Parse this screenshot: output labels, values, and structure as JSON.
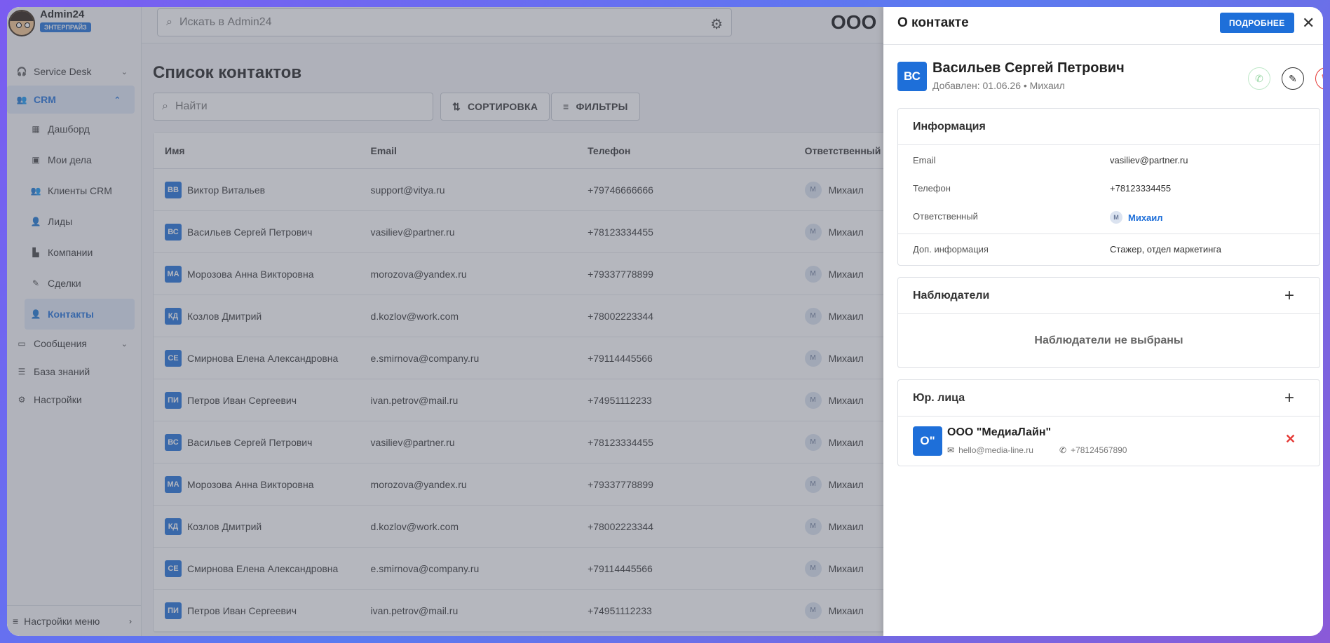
{
  "brand": {
    "name": "Admin24",
    "badge": "ЭНТЕРПРАЙЗ"
  },
  "topbar": {
    "search_placeholder": "Искать в Admin24",
    "org_title": "ООО \""
  },
  "sidebar": {
    "items": [
      {
        "label": "Service Desk"
      },
      {
        "label": "CRM"
      },
      {
        "label": "Дашборд"
      },
      {
        "label": "Мои дела"
      },
      {
        "label": "Клиенты CRM"
      },
      {
        "label": "Лиды"
      },
      {
        "label": "Компании"
      },
      {
        "label": "Сделки"
      },
      {
        "label": "Контакты"
      },
      {
        "label": "Сообщения"
      },
      {
        "label": "База знаний"
      },
      {
        "label": "Настройки"
      }
    ],
    "footer": "Настройки меню"
  },
  "main": {
    "title": "Список контактов",
    "find_placeholder": "Найти",
    "sort_label": "СОРТИРОВКА",
    "filters_label": "ФИЛЬТРЫ",
    "columns": {
      "name": "Имя",
      "email": "Email",
      "phone": "Телефон",
      "resp": "Ответственный"
    },
    "rows": [
      {
        "ini": "ВВ",
        "name": "Виктор Витальев",
        "email": "support@vitya.ru",
        "phone": "+79746666666",
        "resp_ini": "М",
        "resp": "Михаил"
      },
      {
        "ini": "ВС",
        "name": "Васильев Сергей Петрович",
        "email": "vasiliev@partner.ru",
        "phone": "+78123334455",
        "resp_ini": "М",
        "resp": "Михаил"
      },
      {
        "ini": "МА",
        "name": "Морозова Анна Викторовна",
        "email": "morozova@yandex.ru",
        "phone": "+79337778899",
        "resp_ini": "М",
        "resp": "Михаил"
      },
      {
        "ini": "КД",
        "name": "Козлов Дмитрий",
        "email": "d.kozlov@work.com",
        "phone": "+78002223344",
        "resp_ini": "М",
        "resp": "Михаил"
      },
      {
        "ini": "СЕ",
        "name": "Смирнова Елена Александровна",
        "email": "e.smirnova@company.ru",
        "phone": "+79114445566",
        "resp_ini": "М",
        "resp": "Михаил"
      },
      {
        "ini": "ПИ",
        "name": "Петров Иван Сергеевич",
        "email": "ivan.petrov@mail.ru",
        "phone": "+74951112233",
        "resp_ini": "М",
        "resp": "Михаил"
      },
      {
        "ini": "ВС",
        "name": "Васильев Сергей Петрович",
        "email": "vasiliev@partner.ru",
        "phone": "+78123334455",
        "resp_ini": "М",
        "resp": "Михаил"
      },
      {
        "ini": "МА",
        "name": "Морозова Анна Викторовна",
        "email": "morozova@yandex.ru",
        "phone": "+79337778899",
        "resp_ini": "М",
        "resp": "Михаил"
      },
      {
        "ini": "КД",
        "name": "Козлов Дмитрий",
        "email": "d.kozlov@work.com",
        "phone": "+78002223344",
        "resp_ini": "М",
        "resp": "Михаил"
      },
      {
        "ini": "СЕ",
        "name": "Смирнова Елена Александровна",
        "email": "e.smirnova@company.ru",
        "phone": "+79114445566",
        "resp_ini": "М",
        "resp": "Михаил"
      },
      {
        "ini": "ПИ",
        "name": "Петров Иван Сергеевич",
        "email": "ivan.petrov@mail.ru",
        "phone": "+74951112233",
        "resp_ini": "М",
        "resp": "Михаил"
      }
    ]
  },
  "drawer": {
    "title": "О контакте",
    "more_label": "ПОДРОБНЕЕ",
    "close_glyph": "✕",
    "contact": {
      "ini": "ВС",
      "name": "Васильев Сергей Петрович",
      "meta": "Добавлен: 01.06.26 • Михаил"
    },
    "info": {
      "title": "Информация",
      "email_label": "Email",
      "email": "vasiliev@partner.ru",
      "phone_label": "Телефон",
      "phone": "+78123334455",
      "resp_label": "Ответственный",
      "resp_ini": "М",
      "resp": "Михаил",
      "extra_label": "Доп. информация",
      "extra": "Стажер, отдел маркетинга"
    },
    "observers": {
      "title": "Наблюдатели",
      "empty": "Наблюдатели не выбраны"
    },
    "legal": {
      "title": "Юр. лица",
      "org": {
        "ini": "О\"",
        "name": "ООО \"МедиаЛайн\"",
        "email": "hello@media-line.ru",
        "phone": "+78124567890"
      }
    }
  },
  "colors": {
    "accent": "#1e6fd9",
    "danger": "#e53935",
    "frame_gradient": [
      "#7b5cf0",
      "#5a7bf0",
      "#8a5ad8"
    ]
  }
}
